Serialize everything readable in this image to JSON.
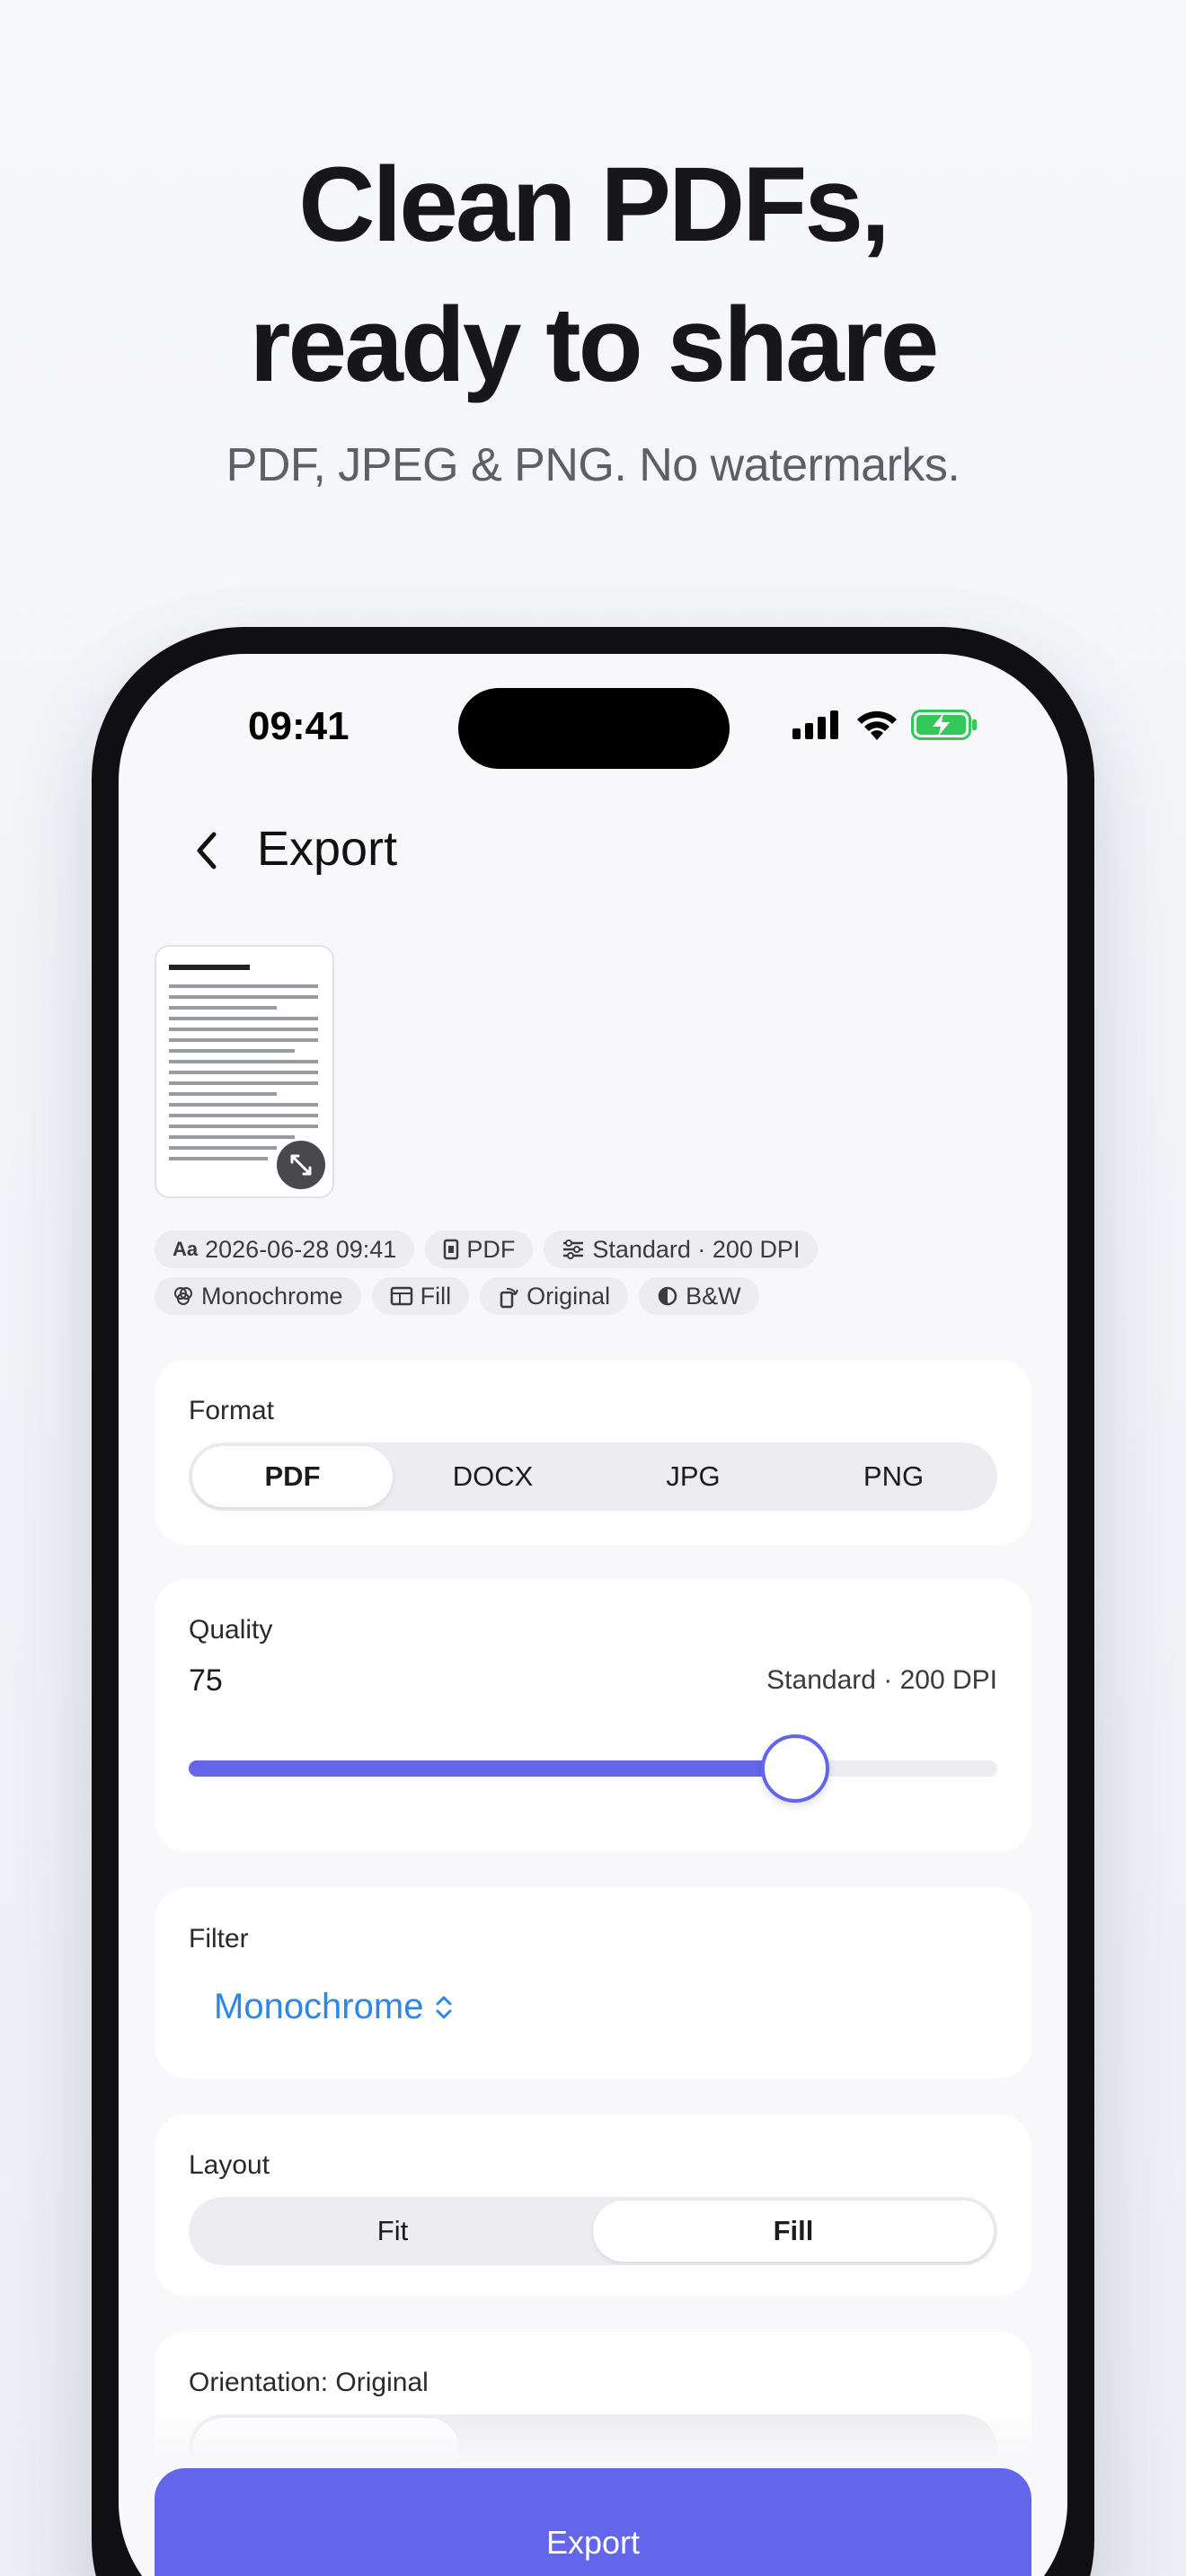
{
  "hero": {
    "title_line1": "Clean PDFs,",
    "title_line2": "ready to share",
    "subtitle": "PDF, JPEG & PNG. No watermarks."
  },
  "status_bar": {
    "time": "09:41"
  },
  "nav": {
    "title": "Export"
  },
  "chips": {
    "row1": [
      {
        "icon": "font-icon",
        "icon_glyph": "Aa",
        "label": "2026-06-28 09:41"
      },
      {
        "icon": "document-icon",
        "label": "PDF"
      },
      {
        "icon": "sliders-icon",
        "label": "Standard · 200 DPI"
      }
    ],
    "row2": [
      {
        "icon": "filter-icon",
        "label": "Monochrome"
      },
      {
        "icon": "layout-icon",
        "label": "Fill"
      },
      {
        "icon": "rotate-icon",
        "label": "Original"
      },
      {
        "icon": "contrast-icon",
        "label": "B&W"
      }
    ]
  },
  "format": {
    "label": "Format",
    "options": [
      "PDF",
      "DOCX",
      "JPG",
      "PNG"
    ],
    "selected": "PDF"
  },
  "quality": {
    "label": "Quality",
    "value": "75",
    "detail": "Standard · 200 DPI",
    "fraction": 0.75
  },
  "filter": {
    "label": "Filter",
    "value": "Monochrome"
  },
  "layout": {
    "label": "Layout",
    "options": [
      "Fit",
      "Fill"
    ],
    "selected": "Fill"
  },
  "orientation": {
    "label": "Orientation: Original"
  },
  "export_button": {
    "label": "Export"
  },
  "colors": {
    "accent": "#6366ea",
    "link": "#2f86e6",
    "battery": "#34c759"
  }
}
